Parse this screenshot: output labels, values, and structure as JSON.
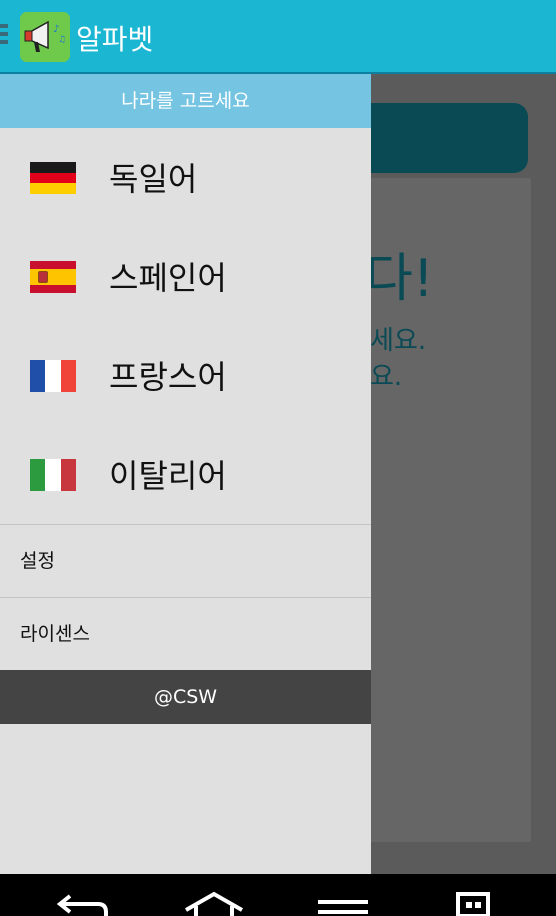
{
  "app": {
    "title": "알파벳"
  },
  "drawer": {
    "header": "나라를 고르세요",
    "languages": [
      {
        "label": "독일어",
        "flag": "germany-flag"
      },
      {
        "label": "스페인어",
        "flag": "spain-flag"
      },
      {
        "label": "프랑스어",
        "flag": "france-flag"
      },
      {
        "label": "이탈리어",
        "flag": "italy-flag"
      }
    ],
    "menu": [
      {
        "label": "설정"
      },
      {
        "label": "라이센스"
      }
    ],
    "footer": "@CSW"
  },
  "background": {
    "big_text": "다!",
    "line1": "세요.",
    "line2": "요."
  },
  "colors": {
    "actionbar": "#1ab6d2",
    "drawer_header": "#74c4e2",
    "footer": "#444444"
  }
}
